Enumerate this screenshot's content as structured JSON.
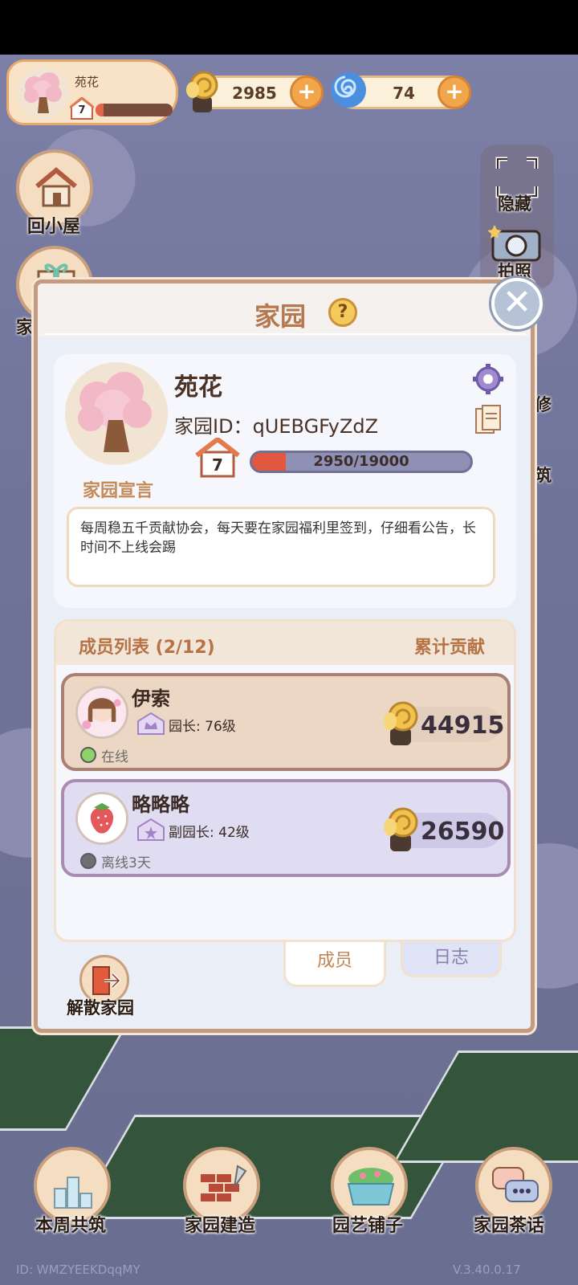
{
  "hud": {
    "player_name": "苑花",
    "player_level": "7",
    "player_progress": 0.1,
    "snail_coins": "2985",
    "spiral_gems": "74"
  },
  "side": {
    "back_home": "回小屋",
    "hide": "隐藏",
    "photo": "拍照",
    "left_partial": "家",
    "right_partial_1": "修",
    "right_partial_2": "筑"
  },
  "modal": {
    "title": "家园",
    "close_symbol": "✕",
    "help_symbol": "?",
    "home": {
      "name": "苑花",
      "id_label": "家园ID：",
      "id_value": "qUEBGFyZdZ",
      "level": "7",
      "xp_text": "2950/19000",
      "xp_current": 2950,
      "xp_max": 19000
    },
    "declaration": {
      "label": "家园宣言",
      "text": "每周稳五千贡献协会，每天要在家园福利里签到，仔细看公告，长时间不上线会踢"
    },
    "members": {
      "count_label": "成员列表 (2/12)",
      "contribution_label": "累计贡献",
      "rows": [
        {
          "name": "伊索",
          "role": "园长: 76级",
          "status": "在线",
          "status_color": "#8fd26a",
          "contribution": "44915"
        },
        {
          "name": "略略略",
          "role": "副园长: 42级",
          "status": "离线3天",
          "status_color": "#6e6e72",
          "contribution": "26590"
        }
      ]
    },
    "tabs": {
      "members": "成员",
      "log": "日志"
    },
    "disband": "解散家园"
  },
  "nav": {
    "weekly_build": "本周共筑",
    "home_build": "家园建造",
    "garden_shop": "园艺铺子",
    "tea_talk": "家园茶话"
  },
  "footer": {
    "id_text": "ID: WMZYEEKDqqMY",
    "version": "V.3.40.0.17"
  },
  "colors": {
    "accent": "#b7774f",
    "xp_fill": "#e2573f",
    "modal_bg": "#e9eef7"
  }
}
